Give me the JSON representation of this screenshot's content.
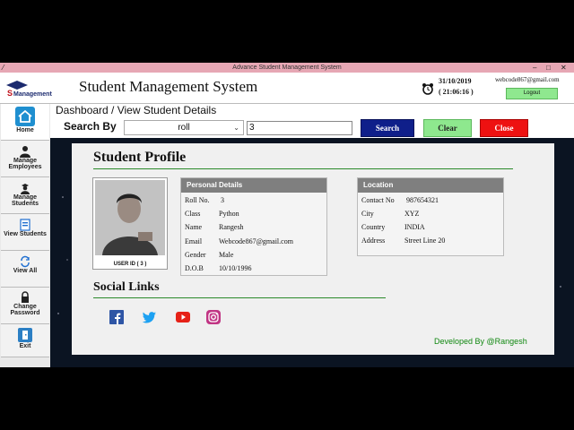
{
  "window": {
    "title": "Advance Student Management System"
  },
  "header": {
    "logo_text": "Management",
    "app_title": "Student Management System",
    "date": "31/10/2019",
    "time": "( 21:06:16 )",
    "email": "webcode867@gmail.com",
    "logout_label": "Logout"
  },
  "sidebar": {
    "items": [
      {
        "label": "Home",
        "icon": "home-icon"
      },
      {
        "label": "Manage Employees",
        "icon": "employee-icon"
      },
      {
        "label": "Manage Students",
        "icon": "students-icon"
      },
      {
        "label": "View Students",
        "icon": "view-students-icon"
      },
      {
        "label": "View All",
        "icon": "refresh-icon"
      },
      {
        "label": "Change Password",
        "icon": "lock-icon"
      },
      {
        "label": "Exit",
        "icon": "exit-icon"
      }
    ]
  },
  "toolbar": {
    "breadcrumb": "Dashboard / View Student Details",
    "search_by_label": "Search By",
    "search_field": "roll",
    "search_value": "3",
    "search_label": "Search",
    "clear_label": "Clear",
    "close_label": "Close"
  },
  "profile": {
    "title": "Student Profile",
    "user_id": "USER ID ( 3 )",
    "personal": {
      "heading": "Personal Details",
      "rows": [
        {
          "label": "Roll No.",
          "value": "3"
        },
        {
          "label": "Class",
          "value": "Python"
        },
        {
          "label": "Name",
          "value": "Rangesh"
        },
        {
          "label": "Email",
          "value": "Webcode867@gmail.com"
        },
        {
          "label": "Gender",
          "value": "Male"
        },
        {
          "label": "D.O.B",
          "value": "10/10/1996"
        }
      ]
    },
    "location": {
      "heading": "Location",
      "rows": [
        {
          "label": "Contact No",
          "value": "987654321"
        },
        {
          "label": "City",
          "value": "XYZ"
        },
        {
          "label": "Country",
          "value": "INDIA"
        },
        {
          "label": "Address",
          "value": "Street Line 20"
        }
      ]
    },
    "social_title": "Social Links",
    "social_icons": [
      "facebook-icon",
      "twitter-icon",
      "youtube-icon",
      "instagram-icon"
    ]
  },
  "footer": {
    "developed_by": "Developed By @Rangesh"
  },
  "colors": {
    "search": "#0f1f8a",
    "clear": "#8ee88e",
    "close": "#ee1111",
    "accent_line": "#2a8a2a",
    "developer": "#118811"
  }
}
